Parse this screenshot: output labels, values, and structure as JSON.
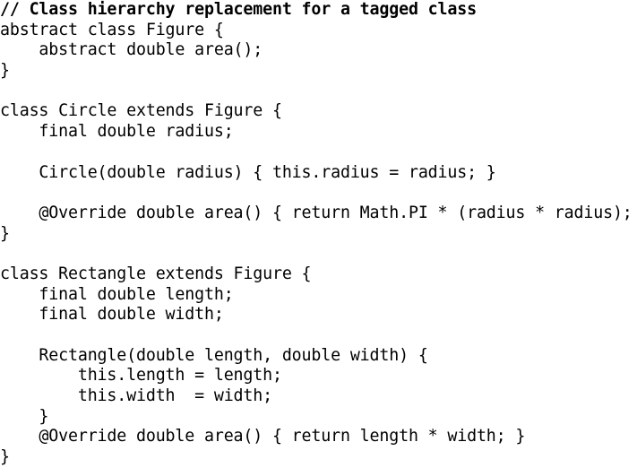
{
  "code": {
    "lines": [
      "// Class hierarchy replacement for a tagged class",
      "abstract class Figure {",
      "    abstract double area();",
      "}",
      "",
      "class Circle extends Figure {",
      "    final double radius;",
      "",
      "    Circle(double radius) { this.radius = radius; }",
      "",
      "    @Override double area() { return Math.PI * (radius * radius); }",
      "}",
      "",
      "class Rectangle extends Figure {",
      "    final double length;",
      "    final double width;",
      "",
      "    Rectangle(double length, double width) {",
      "        this.length = length;",
      "        this.width  = width;",
      "    }",
      "    @Override double area() { return length * width; }",
      "}"
    ]
  }
}
